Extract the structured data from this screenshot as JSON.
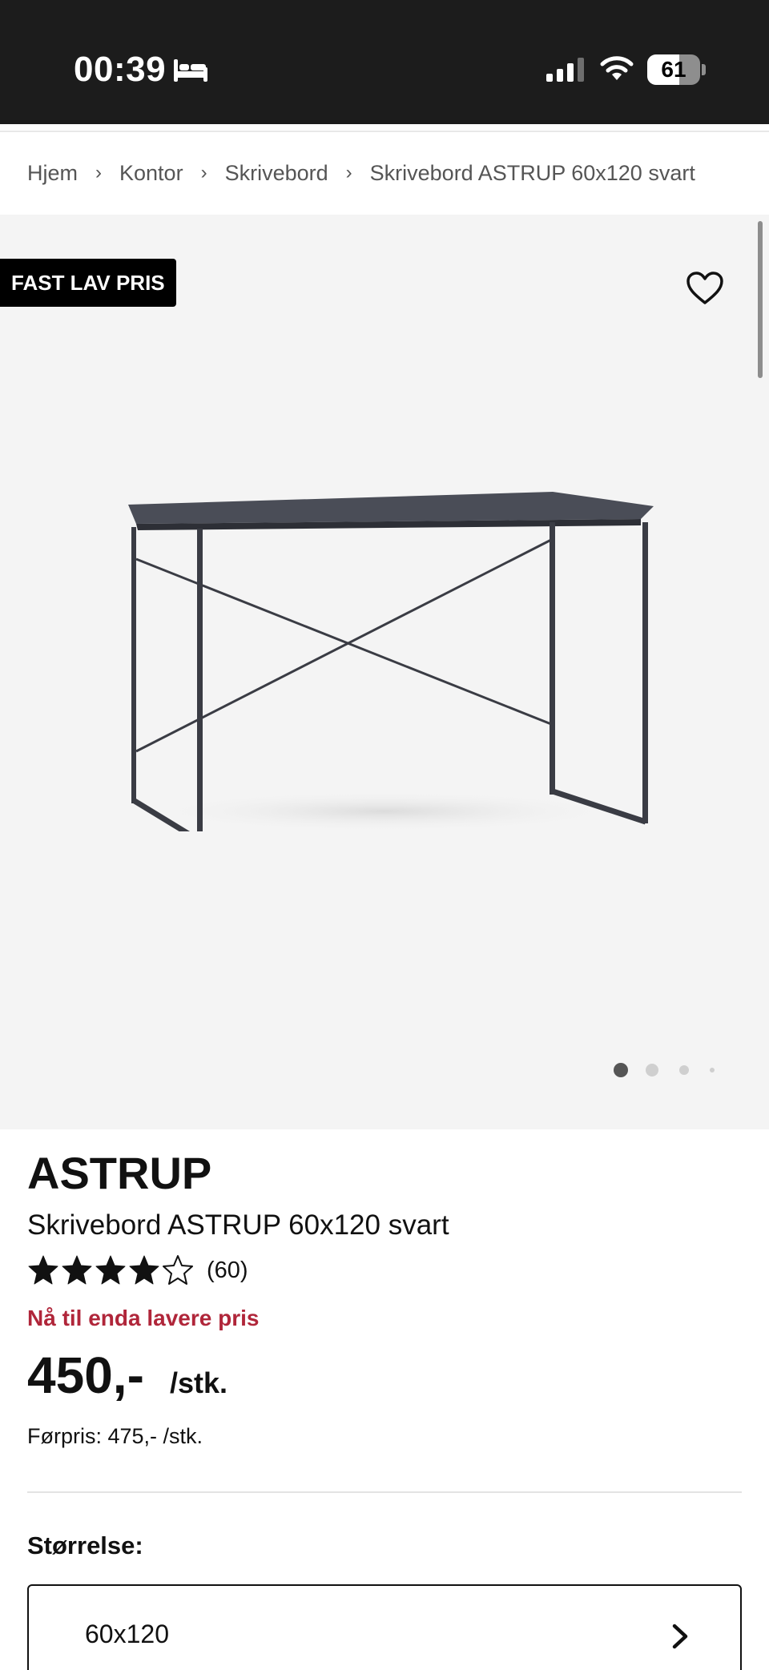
{
  "status_bar": {
    "time": "00:39",
    "battery_percent": "61",
    "battery_level": 0.61,
    "icons": [
      "bed-icon",
      "signal-icon",
      "wifi-icon",
      "battery-icon"
    ]
  },
  "breadcrumb": {
    "items": [
      "Hjem",
      "Kontor",
      "Skrivebord",
      "Skrivebord ASTRUP 60x120 svart"
    ],
    "separator": "›"
  },
  "gallery": {
    "badge": "FAST LAV PRIS",
    "dots_count": 4,
    "active_dot": 0
  },
  "product": {
    "brand": "ASTRUP",
    "name": "Skrivebord ASTRUP 60x120 svart",
    "rating": 4,
    "rating_max": 5,
    "rating_count": "(60)",
    "promo": "Nå til enda lavere pris",
    "price": "450,-",
    "unit": "/stk.",
    "before_price": "Førpris: 475,- /stk."
  },
  "size": {
    "label": "Størrelse:",
    "selected": "60x120"
  },
  "colors": {
    "status_bar_bg": "#1c1c1c",
    "gallery_bg": "#f4f4f4",
    "promo": "#b0263a",
    "badge_bg": "#000000"
  }
}
